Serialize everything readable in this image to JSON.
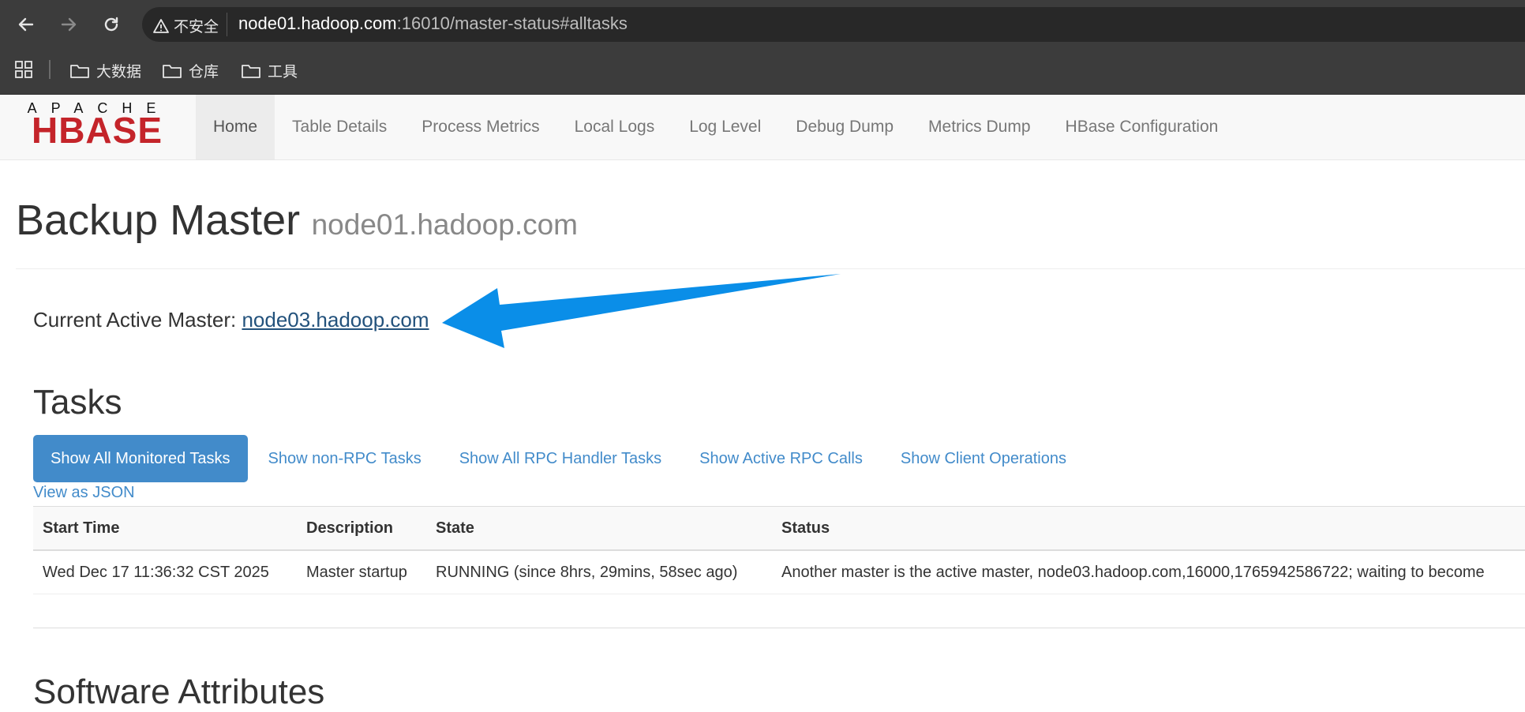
{
  "browser": {
    "security_label": "不安全",
    "url_host": "node01.hadoop.com",
    "url_rest": ":16010/master-status#alltasks",
    "bookmarks": [
      {
        "label": "大数据"
      },
      {
        "label": "仓库"
      },
      {
        "label": "工具"
      }
    ]
  },
  "navbar": {
    "logo_top": "APACHE",
    "logo_main": "HBASE",
    "items": [
      {
        "label": "Home"
      },
      {
        "label": "Table Details"
      },
      {
        "label": "Process Metrics"
      },
      {
        "label": "Local Logs"
      },
      {
        "label": "Log Level"
      },
      {
        "label": "Debug Dump"
      },
      {
        "label": "Metrics Dump"
      },
      {
        "label": "HBase Configuration"
      }
    ]
  },
  "page": {
    "title": "Backup Master",
    "host": "node01.hadoop.com",
    "active_master_label": "Current Active Master:",
    "active_master_link": "node03.hadoop.com"
  },
  "tasks": {
    "heading": "Tasks",
    "tabs": [
      {
        "label": "Show All Monitored Tasks"
      },
      {
        "label": "Show non-RPC Tasks"
      },
      {
        "label": "Show All RPC Handler Tasks"
      },
      {
        "label": "Show Active RPC Calls"
      },
      {
        "label": "Show Client Operations"
      }
    ],
    "json_link": "View as JSON",
    "columns": [
      "Start Time",
      "Description",
      "State",
      "Status"
    ],
    "rows": [
      [
        "Wed Dec 17 11:36:32 CST 2025",
        "Master startup",
        "RUNNING (since 8hrs, 29mins, 58sec ago)",
        "Another master is the active master, node03.hadoop.com,16000,1765942586722; waiting to become"
      ]
    ]
  },
  "software": {
    "heading": "Software Attributes"
  },
  "colors": {
    "link": "#428bca",
    "active_tab": "#428bca",
    "annotation_arrow": "#0a8ee8",
    "logo_red": "#c4242a"
  }
}
